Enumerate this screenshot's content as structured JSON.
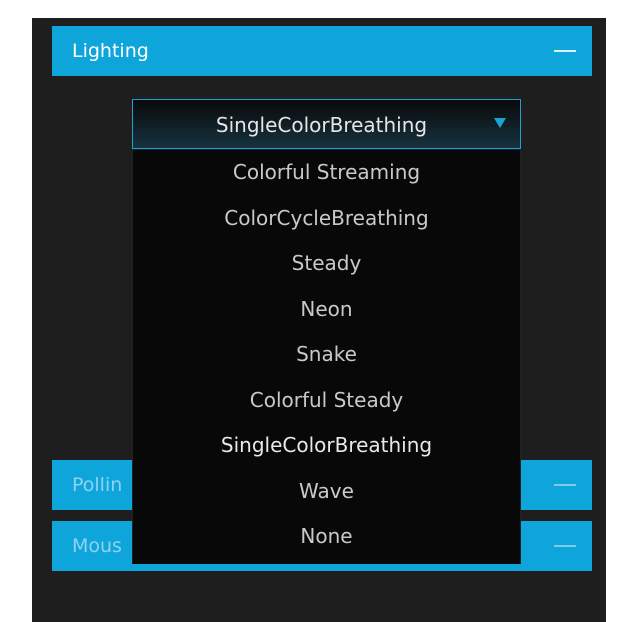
{
  "panels": {
    "lighting": {
      "title": "Lighting"
    },
    "polling": {
      "title": "Pollin"
    },
    "mouse": {
      "title": "Mous"
    }
  },
  "lighting_select": {
    "selected": "SingleColorBreathing",
    "options": [
      "Colorful Streaming",
      "ColorCycleBreathing",
      "Steady",
      "Neon",
      "Snake",
      "Colorful Steady",
      "SingleColorBreathing",
      "Wave",
      "None"
    ]
  },
  "icons": {
    "collapse": "minus-icon",
    "dropdown": "caret-down-icon"
  },
  "colors": {
    "accent": "#0ea5db",
    "background": "#1e1e1e",
    "dropdown_bg": "#080808"
  }
}
